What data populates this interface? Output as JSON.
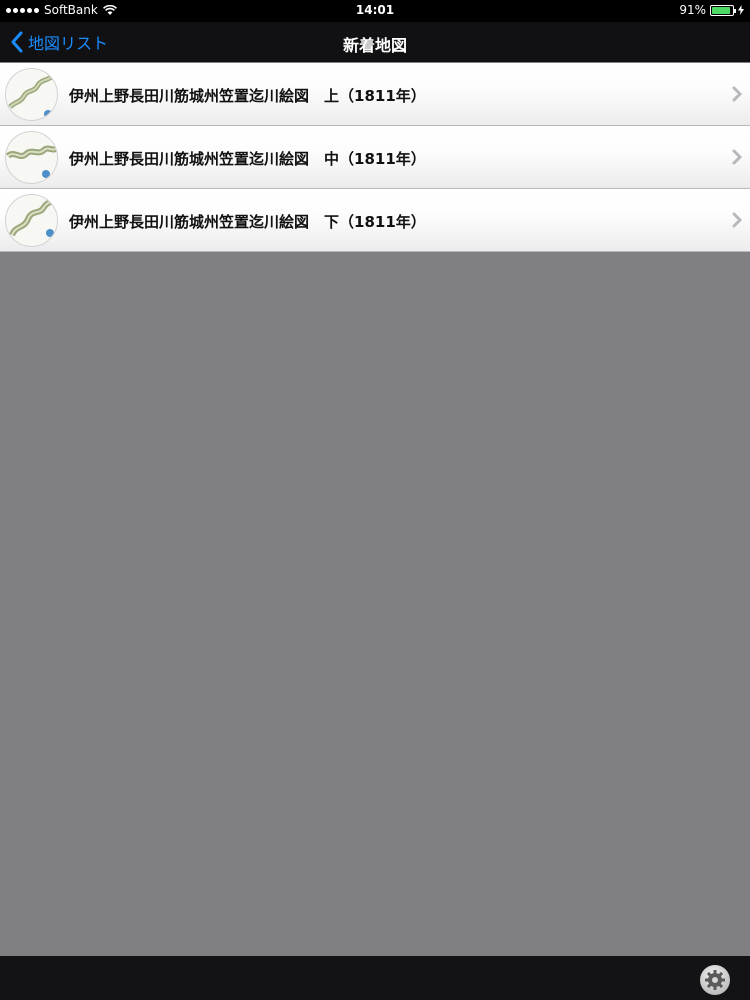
{
  "status_bar": {
    "carrier": "SoftBank",
    "time": "14:01",
    "battery": "91%",
    "battery_level": 0.91,
    "icons": [
      "signal-dots-icon",
      "wifi-icon",
      "battery-icon",
      "charging-bolt-icon"
    ]
  },
  "nav": {
    "back_label": "地図リスト",
    "title": "新着地図",
    "accent_color": "#1a8cff",
    "back_icon": "chevron-left-icon"
  },
  "list": {
    "items": [
      {
        "title": "伊州上野長田川筋城州笠置迄川絵図　上（1811年）",
        "thumbnail_icon": "map-thumbnail"
      },
      {
        "title": "伊州上野長田川筋城州笠置迄川絵図　中（1811年）",
        "thumbnail_icon": "map-thumbnail"
      },
      {
        "title": "伊州上野長田川筋城州笠置迄川絵図　下（1811年）",
        "thumbnail_icon": "map-thumbnail"
      }
    ],
    "disclosure_icon": "chevron-right-icon"
  },
  "toolbar": {
    "settings_icon": "gear-icon"
  },
  "colors": {
    "background": "#807f81",
    "bar_background": "#111113",
    "battery_green": "#4cd964"
  }
}
